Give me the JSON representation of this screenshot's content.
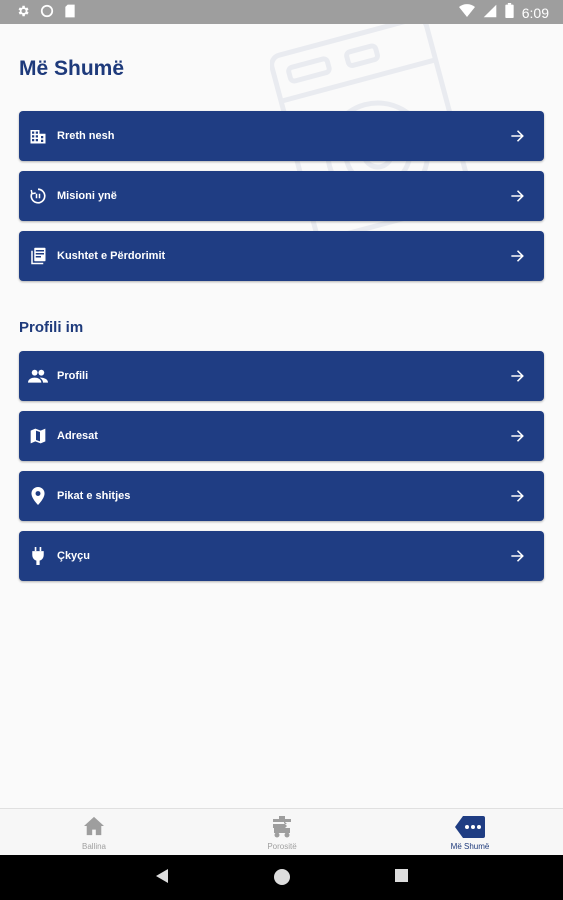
{
  "status_bar": {
    "time": "6:09"
  },
  "page_title": "Më Shumë",
  "info_section": {
    "items": [
      {
        "label": "Rreth nesh",
        "icon": "building-icon"
      },
      {
        "label": "Misioni ynë",
        "icon": "mission-icon"
      },
      {
        "label": "Kushtet e Përdorimit",
        "icon": "document-icon"
      }
    ]
  },
  "profile_section": {
    "title": "Profili im",
    "items": [
      {
        "label": "Profili",
        "icon": "people-icon"
      },
      {
        "label": "Adresat",
        "icon": "map-icon"
      },
      {
        "label": "Pikat e shitjes",
        "icon": "location-pin-icon"
      },
      {
        "label": "Çkyçu",
        "icon": "plug-icon"
      }
    ]
  },
  "bottom_nav": {
    "items": [
      {
        "label": "Ballina",
        "icon": "home-icon",
        "active": false
      },
      {
        "label": "Porositë",
        "icon": "orders-icon",
        "active": false
      },
      {
        "label": "Më Shumë",
        "icon": "more-icon",
        "active": true
      }
    ]
  },
  "colors": {
    "primary": "#1f3d83",
    "title": "#1e3a7b",
    "status_bar": "#9e9e9e",
    "inactive_nav": "#a0a0a0"
  }
}
